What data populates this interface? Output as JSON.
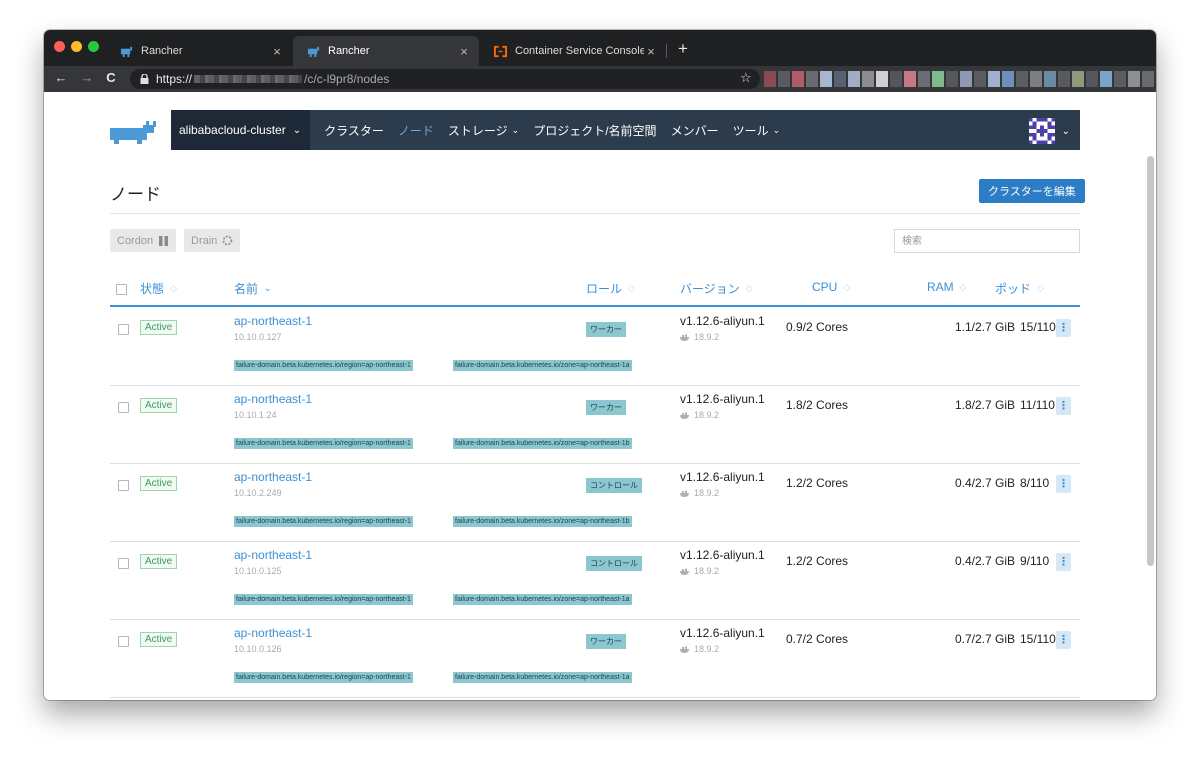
{
  "browser": {
    "tabs": [
      {
        "title": "Rancher"
      },
      {
        "title": "Rancher"
      },
      {
        "title": "Container Service Console"
      }
    ],
    "new_tab_label": "+",
    "url_scheme": "https://",
    "url_path": "/c/c-l9pr8/nodes",
    "nav": {
      "back": "←",
      "forward": "→",
      "reload": "C"
    },
    "star": "☆",
    "tab_close": "×"
  },
  "header": {
    "cluster": "alibabacloud-cluster",
    "nav": [
      {
        "label": "クラスター",
        "caret": ""
      },
      {
        "label": "ノード",
        "caret": ""
      },
      {
        "label": "ストレージ",
        "caret": "⌄"
      },
      {
        "label": "プロジェクト/名前空間",
        "caret": ""
      },
      {
        "label": "メンバー",
        "caret": ""
      },
      {
        "label": "ツール",
        "caret": "⌄"
      }
    ],
    "caret": "⌄"
  },
  "page": {
    "title": "ノード",
    "edit_button": "クラスターを編集"
  },
  "toolbar": {
    "cordon": "Cordon",
    "drain": "Drain",
    "search_placeholder": "検索"
  },
  "table": {
    "columns": {
      "state": "状態",
      "name": "名前",
      "role": "ロール",
      "version": "バージョン",
      "cpu": "CPU",
      "ram": "RAM",
      "pods": "ポッド"
    },
    "sort_icon": "◇",
    "sort_active_icon": "⌄",
    "kebab": "⋮",
    "rows": [
      {
        "state": "Active",
        "name": "ap-northeast-1",
        "ip": "10.10.0.127",
        "role": "ワーカー",
        "version": "v1.12.6-aliyun.1",
        "docker": "18.9.2",
        "cpu": "0.9/2 Cores",
        "ram": "1.1/2.7 GiB",
        "pods": "15/110",
        "labels": [
          "failure-domain.beta.kubernetes.io/region=ap-northeast-1",
          "failure-domain.beta.kubernetes.io/zone=ap-northeast-1a"
        ]
      },
      {
        "state": "Active",
        "name": "ap-northeast-1",
        "ip": "10.10.1.24",
        "role": "ワーカー",
        "version": "v1.12.6-aliyun.1",
        "docker": "18.9.2",
        "cpu": "1.8/2 Cores",
        "ram": "1.8/2.7 GiB",
        "pods": "11/110",
        "labels": [
          "failure-domain.beta.kubernetes.io/region=ap-northeast-1",
          "failure-domain.beta.kubernetes.io/zone=ap-northeast-1b"
        ]
      },
      {
        "state": "Active",
        "name": "ap-northeast-1",
        "ip": "10.10.2.249",
        "role": "コントロール",
        "version": "v1.12.6-aliyun.1",
        "docker": "18.9.2",
        "cpu": "1.2/2 Cores",
        "ram": "0.4/2.7 GiB",
        "pods": "8/110",
        "labels": [
          "failure-domain.beta.kubernetes.io/region=ap-northeast-1",
          "failure-domain.beta.kubernetes.io/zone=ap-northeast-1b"
        ]
      },
      {
        "state": "Active",
        "name": "ap-northeast-1",
        "ip": "10.10.0.125",
        "role": "コントロール",
        "version": "v1.12.6-aliyun.1",
        "docker": "18.9.2",
        "cpu": "1.2/2 Cores",
        "ram": "0.4/2.7 GiB",
        "pods": "9/110",
        "labels": [
          "failure-domain.beta.kubernetes.io/region=ap-northeast-1",
          "failure-domain.beta.kubernetes.io/zone=ap-northeast-1a"
        ]
      },
      {
        "state": "Active",
        "name": "ap-northeast-1",
        "ip": "10.10.0.126",
        "role": "ワーカー",
        "version": "v1.12.6-aliyun.1",
        "docker": "18.9.2",
        "cpu": "0.7/2 Cores",
        "ram": "0.7/2.7 GiB",
        "pods": "15/110",
        "labels": [
          "failure-domain.beta.kubernetes.io/region=ap-northeast-1",
          "failure-domain.beta.kubernetes.io/zone=ap-northeast-1a"
        ]
      }
    ]
  },
  "colors": {
    "header_bg": "#2d3c4d",
    "cluster_bg": "#1e2937",
    "accent": "#3d8fd6",
    "button": "#2d7cc6",
    "active_green": "#3a9b5b",
    "label_teal": "#8bc7cf"
  },
  "icons": {
    "rancher": "rancher-cow-icon",
    "aliyun": "aliyun-bracket-icon",
    "docker": "docker-whale-icon",
    "lock": "lock-icon",
    "avatar": "pixel-avatar-icon"
  }
}
